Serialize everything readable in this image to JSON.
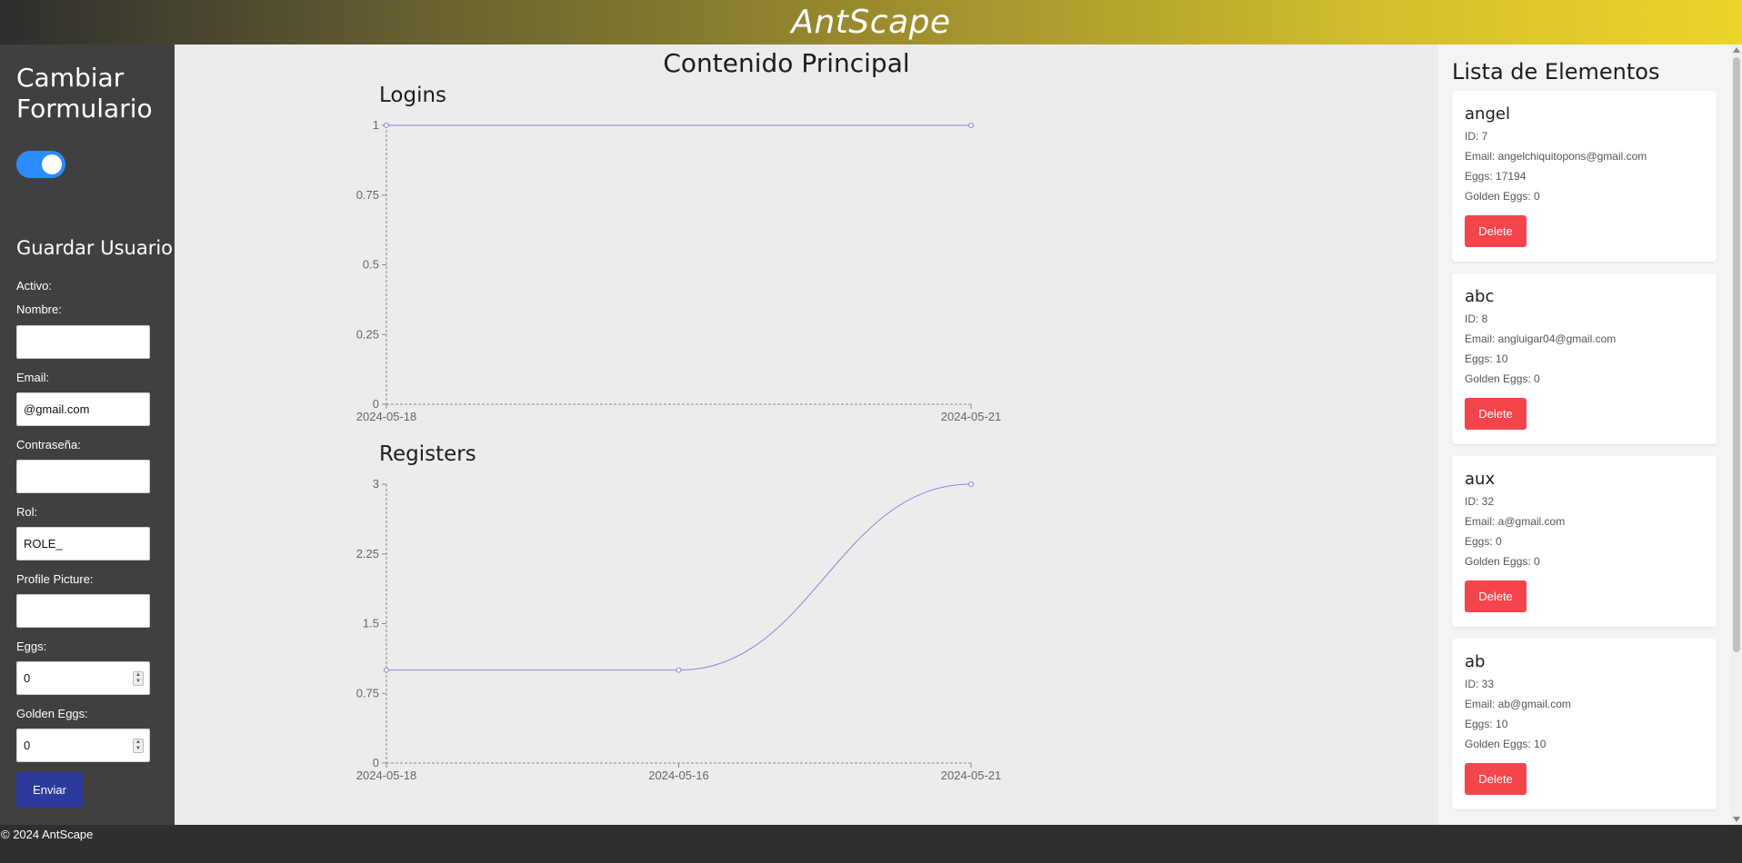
{
  "header": {
    "brand": "AntScape"
  },
  "sidebar": {
    "title": "Cambiar Formulario",
    "toggle_on": true,
    "section": "Guardar Usuario",
    "labels": {
      "activo": "Activo:",
      "nombre": "Nombre:",
      "email": "Email:",
      "password": "Contraseña:",
      "rol": "Rol:",
      "picture": "Profile Picture:",
      "eggs": "Eggs:",
      "golden": "Golden Eggs:"
    },
    "values": {
      "nombre": "",
      "email": "@gmail.com",
      "password": "",
      "rol": "ROLE_",
      "picture": "",
      "eggs": "0",
      "golden": "0"
    },
    "submit": "Enviar"
  },
  "main": {
    "title": "Contenido Principal"
  },
  "chart_data": [
    {
      "type": "line",
      "title": "Logins",
      "x": [
        "2024-05-18",
        "2024-05-21"
      ],
      "values": [
        1,
        1
      ],
      "yticks": [
        "0",
        "0.25",
        "0.5",
        "0.75",
        "1"
      ],
      "ylim": [
        0,
        1
      ],
      "grid": false,
      "color": "#8884d8"
    },
    {
      "type": "line",
      "title": "Registers",
      "x": [
        "2024-05-18",
        "2024-05-16",
        "2024-05-21"
      ],
      "values": [
        1,
        1,
        3
      ],
      "yticks": [
        "0",
        "0.75",
        "1.5",
        "2.25",
        "3"
      ],
      "ylim": [
        0,
        3
      ],
      "grid": false,
      "color": "#8884d8"
    }
  ],
  "list": {
    "title": "Lista de Elementos",
    "delete_label": "Delete",
    "items": [
      {
        "name": "angel",
        "id": "ID: 7",
        "email": "Email: angelchiquitopons@gmail.com",
        "eggs": "Eggs: 17194",
        "golden": "Golden Eggs: 0"
      },
      {
        "name": "abc",
        "id": "ID: 8",
        "email": "Email: angluigar04@gmail.com",
        "eggs": "Eggs: 10",
        "golden": "Golden Eggs: 0"
      },
      {
        "name": "aux",
        "id": "ID: 32",
        "email": "Email: a@gmail.com",
        "eggs": "Eggs: 0",
        "golden": "Golden Eggs: 0"
      },
      {
        "name": "ab",
        "id": "ID: 33",
        "email": "Email: ab@gmail.com",
        "eggs": "Eggs: 10",
        "golden": "Golden Eggs: 10"
      }
    ]
  },
  "footer": {
    "text": "© 2024 AntScape"
  },
  "colors": {
    "accent": "#2a8cff",
    "delete": "#f4444c",
    "submit": "#2c3a9e",
    "line": "#8884d8"
  }
}
